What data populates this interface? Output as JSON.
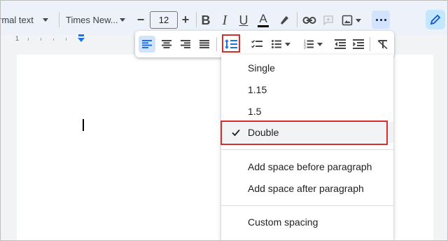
{
  "toolbar": {
    "style_label": "rmal text",
    "font_label": "Times New...",
    "font_size": "12",
    "minus": "−",
    "plus": "+",
    "bold": "B",
    "italic": "I",
    "underline": "U",
    "text_color": "A"
  },
  "ruler": {
    "number": "1"
  },
  "menu": {
    "items": [
      "Single",
      "1.15",
      "1.5",
      "Double",
      "Add space before paragraph",
      "Add space after paragraph",
      "Custom spacing"
    ],
    "selected": "Double"
  },
  "colors": {
    "toolbar_bg": "#edf2fa",
    "active_blue": "#d3e3fd",
    "accent_blue": "#1a73e8",
    "highlight_red": "#d32f2f"
  },
  "icons": [
    "caret-down-icon",
    "link-icon",
    "add-comment-icon",
    "insert-image-icon",
    "more-icon",
    "pencil-icon",
    "align-left-icon",
    "align-center-icon",
    "align-right-icon",
    "align-justify-icon",
    "line-spacing-icon",
    "checklist-icon",
    "bulleted-list-icon",
    "numbered-list-icon",
    "decrease-indent-icon",
    "increase-indent-icon",
    "clear-formatting-icon",
    "check-icon"
  ]
}
